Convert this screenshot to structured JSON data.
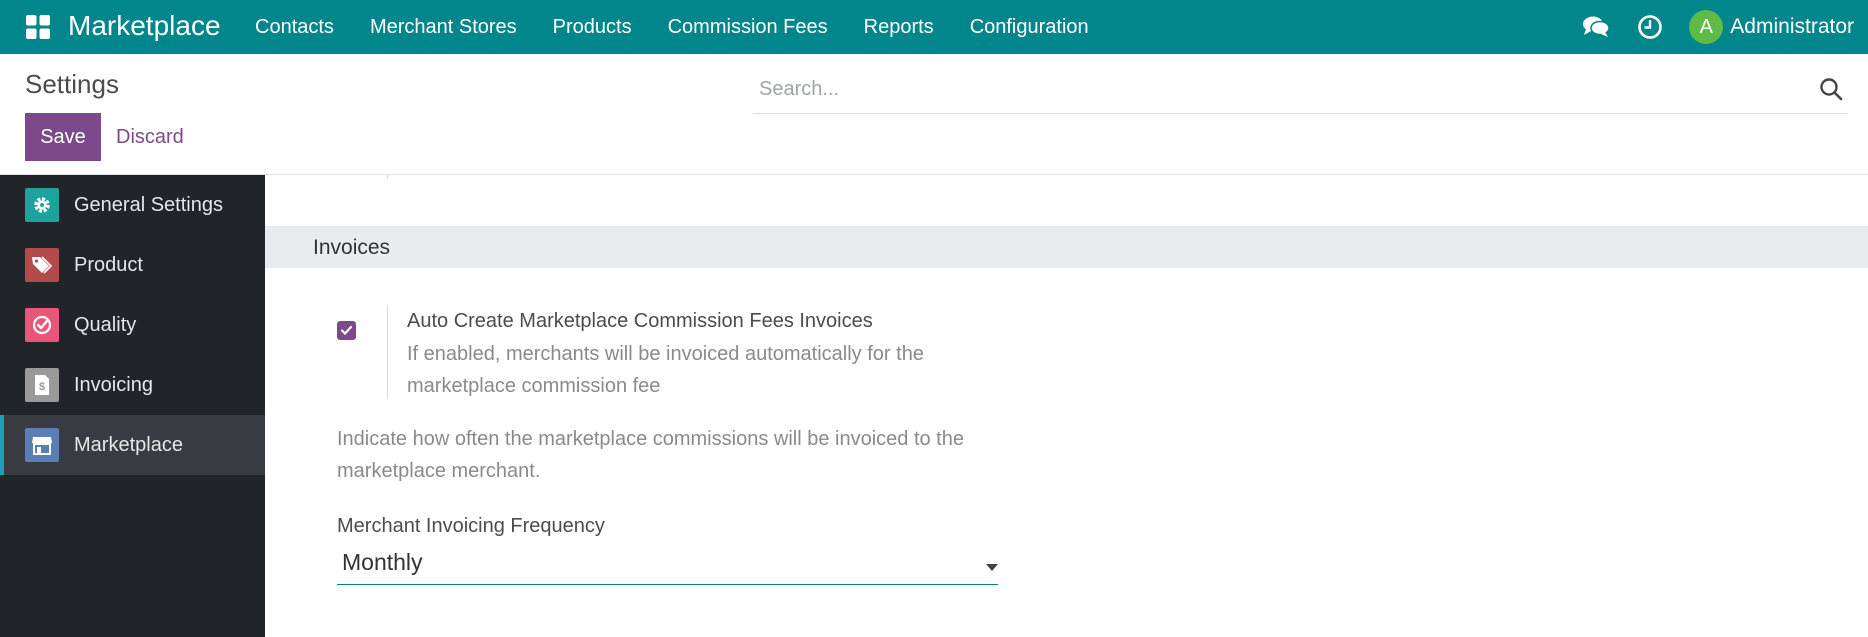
{
  "navbar": {
    "brand": "Marketplace",
    "menu": [
      "Contacts",
      "Merchant Stores",
      "Products",
      "Commission Fees",
      "Reports",
      "Configuration"
    ],
    "user": {
      "initial": "A",
      "name": "Administrator"
    },
    "icons": [
      "apps-grid-icon",
      "chat-icon",
      "clock-icon"
    ]
  },
  "control_panel": {
    "title": "Settings",
    "search_placeholder": "Search...",
    "save_label": "Save",
    "discard_label": "Discard"
  },
  "sidebar": {
    "items": [
      {
        "label": "General Settings",
        "icon": "gear-icon",
        "color": "#1ba39c"
      },
      {
        "label": "Product",
        "icon": "tags-icon",
        "color": "#b34b4b"
      },
      {
        "label": "Quality",
        "icon": "check-badge-icon",
        "color": "#e8577a"
      },
      {
        "label": "Invoicing",
        "icon": "invoice-icon",
        "color": "#9a9a9a"
      },
      {
        "label": "Marketplace",
        "icon": "store-icon",
        "color": "#5b7fb2"
      }
    ],
    "active": "Marketplace"
  },
  "section": {
    "title": "Invoices",
    "auto_invoice": {
      "checked": true,
      "title": "Auto Create Marketplace Commission Fees Invoices",
      "description": "If enabled, merchants will be invoiced automatically for the marketplace commission fee"
    },
    "info": "Indicate how often the marketplace commissions will be invoiced to the marketplace merchant.",
    "frequency": {
      "label": "Merchant Invoicing Frequency",
      "value": "Monthly"
    }
  },
  "colors": {
    "navbar": "#00868b",
    "primary": "#7c4a8b",
    "sidebar": "#212429",
    "sidebar_active": "#383c42",
    "active_indicator": "#17a2b8"
  }
}
